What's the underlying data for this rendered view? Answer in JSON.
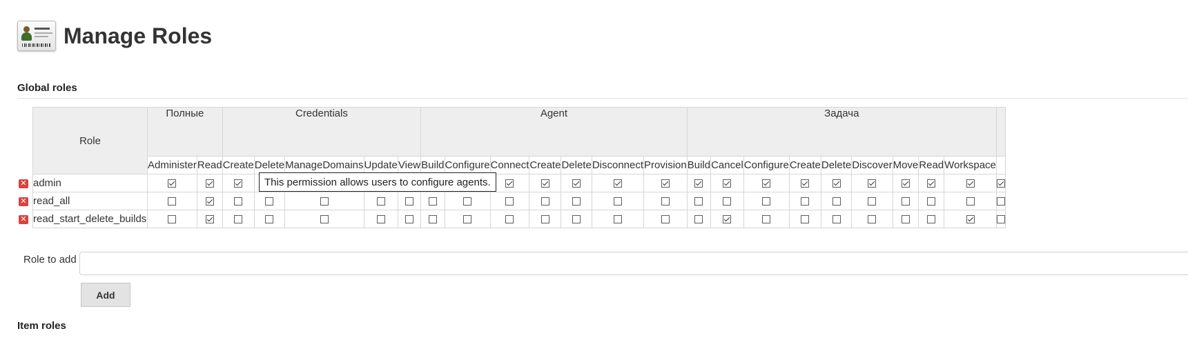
{
  "page": {
    "title": "Manage Roles",
    "logo_icon": "id-card-icon"
  },
  "global_roles": {
    "title": "Global roles",
    "role_header": "Role",
    "groups": [
      {
        "label": "Полные",
        "perms": [
          "Administer",
          "Read"
        ]
      },
      {
        "label": "Credentials",
        "perms": [
          "Create",
          "Delete",
          "ManageDomains",
          "Update",
          "View"
        ]
      },
      {
        "label": "Agent",
        "perms": [
          "Build",
          "Configure",
          "Connect",
          "Create",
          "Delete",
          "Disconnect",
          "Provision"
        ]
      },
      {
        "label": "Задача",
        "perms": [
          "Build",
          "Cancel",
          "Configure",
          "Create",
          "Delete",
          "Discover",
          "Move",
          "Read",
          "Workspace"
        ]
      },
      {
        "label": "",
        "perms": [
          ""
        ]
      }
    ],
    "roles": [
      {
        "name": "admin",
        "checks": [
          1,
          1,
          1,
          0,
          0,
          0,
          0,
          0,
          1,
          1,
          1,
          1,
          1,
          1,
          1,
          1,
          1,
          1,
          1,
          1,
          1,
          1,
          1,
          1
        ]
      },
      {
        "name": "read_all",
        "checks": [
          0,
          1,
          0,
          0,
          0,
          0,
          0,
          0,
          0,
          0,
          0,
          0,
          0,
          0,
          0,
          0,
          0,
          0,
          0,
          0,
          0,
          0,
          0,
          0
        ]
      },
      {
        "name": "read_start_delete_builds",
        "checks": [
          0,
          1,
          0,
          0,
          0,
          0,
          0,
          0,
          0,
          0,
          0,
          0,
          0,
          0,
          0,
          1,
          0,
          0,
          0,
          0,
          0,
          0,
          1,
          0
        ]
      }
    ],
    "delete_icon": "delete-icon"
  },
  "tooltip": "This permission allows users to configure agents.",
  "add_role": {
    "label": "Role to add",
    "value": "",
    "placeholder": "",
    "button": "Add"
  },
  "item_roles": {
    "title": "Item roles"
  }
}
